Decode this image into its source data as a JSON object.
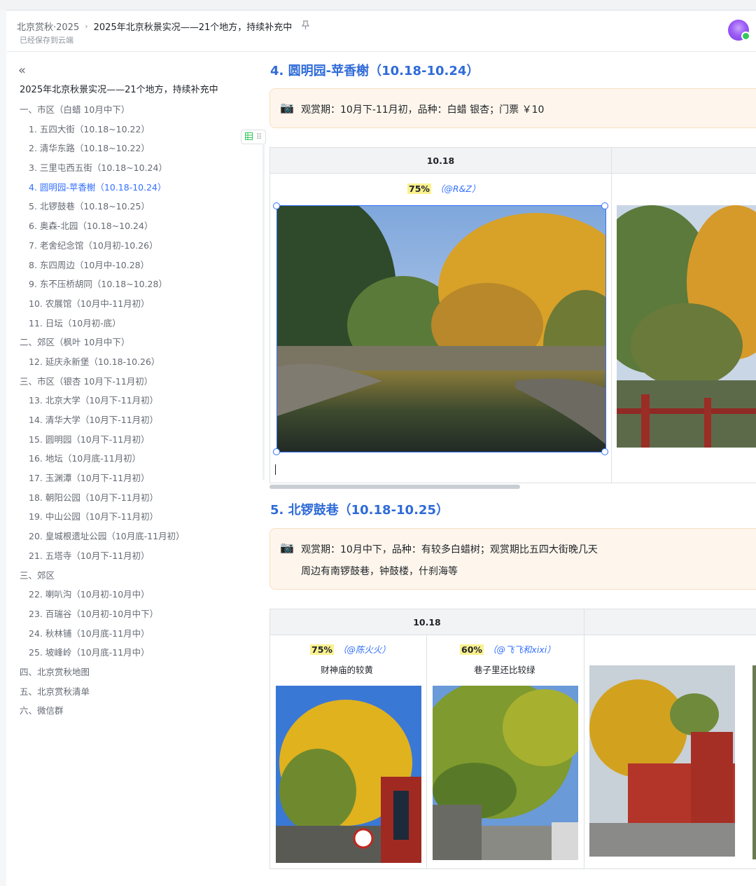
{
  "header": {
    "breadcrumb_parent": "北京赏秋·2025",
    "breadcrumb_current": "2025年北京秋景实况——21个地方，持续补充中",
    "saved_status": "已经保存到云端",
    "pin_icon": "pin-icon",
    "avatar_color": "#9c5cf5"
  },
  "toc": {
    "collapse_icon": "«",
    "title": "2025年北京秋景实况——21个地方，持续补充中",
    "items": [
      {
        "label": "一、市区（白蜡 10月中下）",
        "level": 1
      },
      {
        "label": "1. 五四大街（10.18~10.22）",
        "level": 2
      },
      {
        "label": "2. 清华东路（10.18~10.22）",
        "level": 2
      },
      {
        "label": "3. 三里屯西五街（10.18~10.24）",
        "level": 2
      },
      {
        "label": "4. 圆明园-苹香榭（10.18-10.24）",
        "level": 2,
        "active": true
      },
      {
        "label": "5. 北锣鼓巷（10.18~10.25）",
        "level": 2
      },
      {
        "label": "6. 奥森-北园（10.18~10.24）",
        "level": 2
      },
      {
        "label": "7. 老舍纪念馆（10月初-10.26）",
        "level": 2
      },
      {
        "label": "8. 东四周边（10月中-10.28）",
        "level": 2
      },
      {
        "label": "9. 东不压桥胡同（10.18~10.28）",
        "level": 2
      },
      {
        "label": "10. 农展馆（10月中-11月初）",
        "level": 2
      },
      {
        "label": "11. 日坛（10月初-底）",
        "level": 2
      },
      {
        "label": "二、郊区（枫叶 10月中下）",
        "level": 1
      },
      {
        "label": "12. 延庆永新堡（10.18-10.26）",
        "level": 2
      },
      {
        "label": "三、市区（银杏 10月下-11月初）",
        "level": 1
      },
      {
        "label": "13. 北京大学（10月下-11月初）",
        "level": 2
      },
      {
        "label": "14. 清华大学（10月下-11月初）",
        "level": 2
      },
      {
        "label": "15. 圆明园（10月下-11月初）",
        "level": 2
      },
      {
        "label": "16. 地坛（10月底-11月初）",
        "level": 2
      },
      {
        "label": "17. 玉渊潭（10月下-11月初）",
        "level": 2
      },
      {
        "label": "18. 朝阳公园（10月下-11月初）",
        "level": 2
      },
      {
        "label": "19. 中山公园（10月下-11月初）",
        "level": 2
      },
      {
        "label": "20. 皇城根遗址公园（10月底-11月初）",
        "level": 2
      },
      {
        "label": "21. 五塔寺（10月下-11月初）",
        "level": 2
      },
      {
        "label": "三、郊区",
        "level": 1
      },
      {
        "label": "22. 喇叭沟（10月初-10月中）",
        "level": 2
      },
      {
        "label": "23. 百瑞谷（10月初-10月中下）",
        "level": 2
      },
      {
        "label": "24. 秋林铺（10月底-11月中）",
        "level": 2
      },
      {
        "label": "25. 坡峰岭（10月底-11月中）",
        "level": 2
      },
      {
        "label": "四、北京赏秋地图",
        "level": 1
      },
      {
        "label": "五、北京赏秋清单",
        "level": 1
      },
      {
        "label": "六、微信群",
        "level": 1
      }
    ]
  },
  "section4": {
    "heading": "4. 圆明园-苹香榭（10.18-10.24）",
    "callout_icon": "📷",
    "callout_text": "观赏期：10月下-11月初，品种：白蜡 银杏；门票 ￥10",
    "table": {
      "col1_header": "10.18",
      "col1_pct": "75%",
      "col1_by": "（@R&Z）",
      "photo1": "yuanmingyuan-lake-photo",
      "photo2": "yuanmingyuan-bridge-photo"
    }
  },
  "section5": {
    "heading": "5. 北锣鼓巷（10.18-10.25）",
    "callout_icon": "📷",
    "callout_line1": "观赏期：10月中下，品种：有较多白蜡树；观赏期比五四大街晚几天",
    "callout_line2": "周边有南锣鼓巷，钟鼓楼，什刹海等",
    "table": {
      "col1_header": "10.18",
      "cells": [
        {
          "pct": "75%",
          "by": "（@陈火火）",
          "caption": "财神庙的较黄",
          "photo": "caishen-temple-photo"
        },
        {
          "pct": "60%",
          "by": "（@飞飞和xixi）",
          "caption": "巷子里还比较绿",
          "photo": "hutong-green-photo"
        }
      ],
      "photo3": "red-wall-street-photo"
    }
  },
  "toolbar": {
    "table_icon": "table-icon",
    "grip_icon": "drag-handle-icon"
  }
}
